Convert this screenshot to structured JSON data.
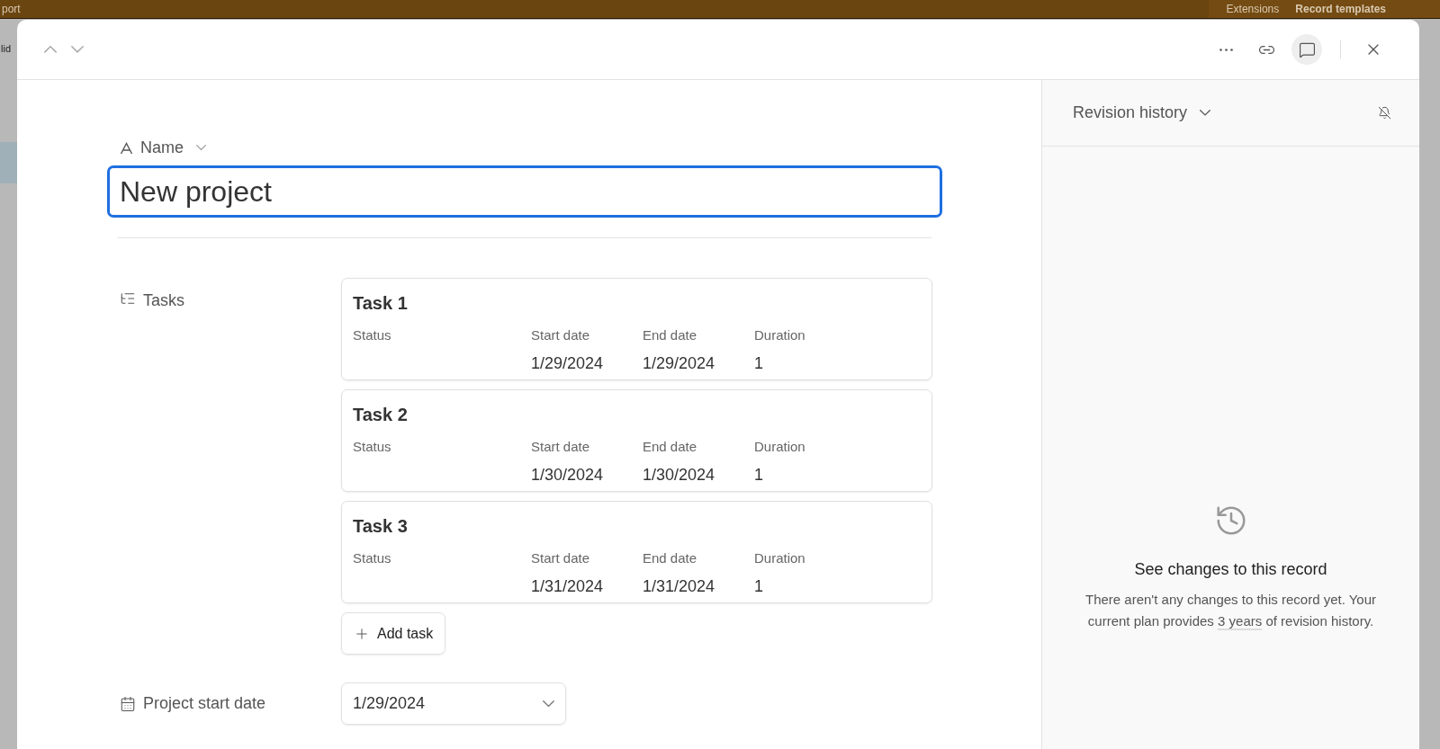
{
  "background": {
    "top_left_text": "port",
    "top_right_items": [
      "Extensions",
      "Record templates"
    ],
    "side_text": "lid"
  },
  "header": {
    "comments_open": true
  },
  "name_field": {
    "label": "Name",
    "value": "New project",
    "focused": true
  },
  "tasks_field": {
    "label": "Tasks",
    "add_button": "Add task",
    "tasks": [
      {
        "title": "Task 1",
        "status_label": "Status",
        "start_label": "Start date",
        "start": "1/29/2024",
        "end_label": "End date",
        "end": "1/29/2024",
        "duration_label": "Duration",
        "duration": "1"
      },
      {
        "title": "Task 2",
        "status_label": "Status",
        "start_label": "Start date",
        "start": "1/30/2024",
        "end_label": "End date",
        "end": "1/30/2024",
        "duration_label": "Duration",
        "duration": "1"
      },
      {
        "title": "Task 3",
        "status_label": "Status",
        "start_label": "Start date",
        "start": "1/31/2024",
        "end_label": "End date",
        "end": "1/31/2024",
        "duration_label": "Duration",
        "duration": "1"
      }
    ]
  },
  "start_date_field": {
    "label": "Project start date",
    "value": "1/29/2024"
  },
  "revision_panel": {
    "title": "Revision history",
    "empty_title": "See changes to this record",
    "text_before": "There aren't any changes to this record yet. Your current plan provides",
    "link": "3 years",
    "text_after": "of revision history."
  }
}
